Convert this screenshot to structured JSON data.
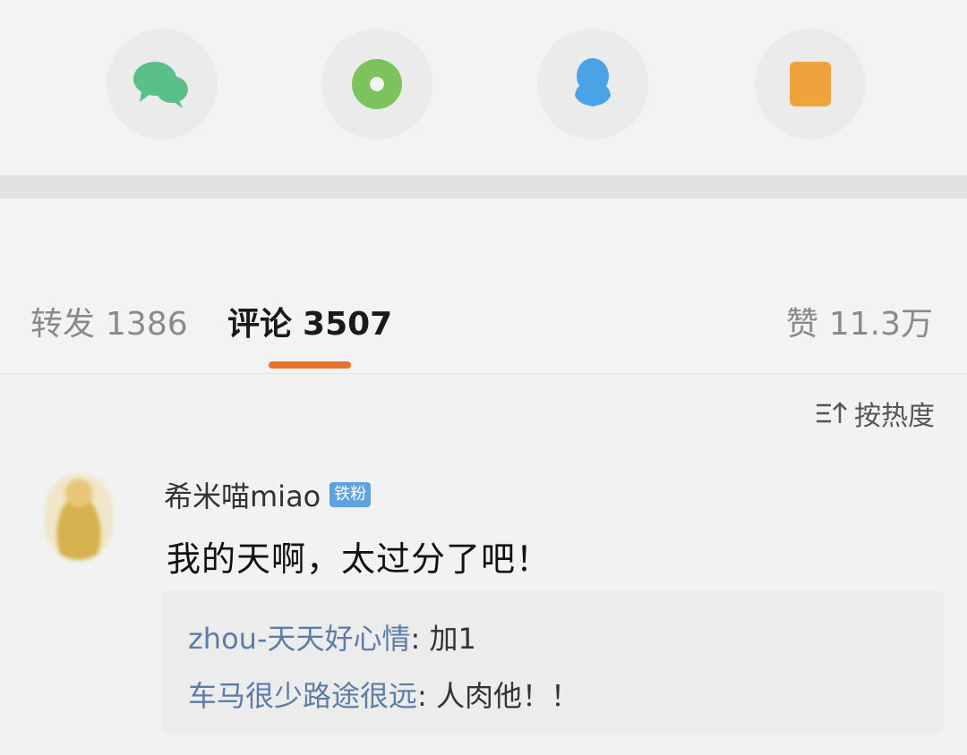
{
  "share": {
    "items": [
      {
        "name": "wechat",
        "icon": "wechat-icon",
        "color": "#5bbf8a"
      },
      {
        "name": "moments",
        "icon": "moments-icon",
        "color": "#7cc35e"
      },
      {
        "name": "qq",
        "icon": "qq-icon",
        "color": "#4aa3e6"
      },
      {
        "name": "notes",
        "icon": "notes-icon",
        "color": "#f0a23c"
      }
    ]
  },
  "tabs": {
    "repost_label": "转发",
    "repost_count": "1386",
    "comment_label": "评论",
    "comment_count": "3507",
    "like_label": "赞",
    "like_count": "11.3万",
    "accent_color": "#e8732c"
  },
  "sort": {
    "label": "按热度",
    "icon": "sort-icon"
  },
  "comment": {
    "username": "希米喵miao",
    "badge": "铁粉",
    "text": "我的天啊，太过分了吧！",
    "replies": [
      {
        "user": "zhou-天天好心情",
        "sep": ": ",
        "text": "加1"
      },
      {
        "user": "车马很少路途很远",
        "sep": ": ",
        "text": "人肉他！！"
      }
    ]
  }
}
